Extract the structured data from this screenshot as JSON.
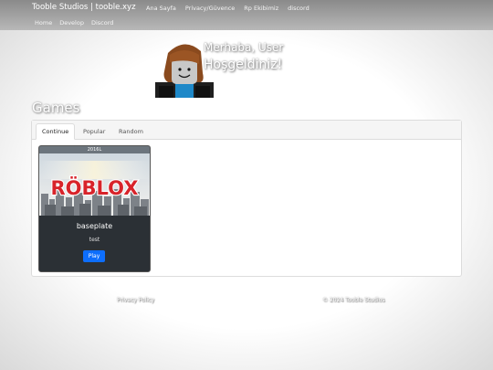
{
  "header": {
    "brand": "Tooble Studios | tooble.xyz",
    "nav": [
      "Ana Sayfa",
      "Privacy/Güvence",
      "Rp Ekibimiz",
      "discord"
    ],
    "subnav": [
      "Home",
      "Develop",
      "Discord"
    ]
  },
  "greeting": {
    "line1": "Merhaba, User",
    "line2": "Hoşgeldiniz!"
  },
  "games": {
    "title": "Games",
    "tabs": [
      "Continue",
      "Popular",
      "Random"
    ],
    "active_tab": "Continue",
    "cards": [
      {
        "badge": "2016L",
        "thumb_text": "RÖBLOX",
        "title": "baseplate",
        "description": "test",
        "button": "Play"
      }
    ]
  },
  "footer": {
    "privacy": "Privacy Policy",
    "copyright": "© 2024 Tooble Studios"
  },
  "colors": {
    "accent": "#0d6efd",
    "topbar": "#9a9a9a",
    "card_bg": "#2b3035"
  }
}
